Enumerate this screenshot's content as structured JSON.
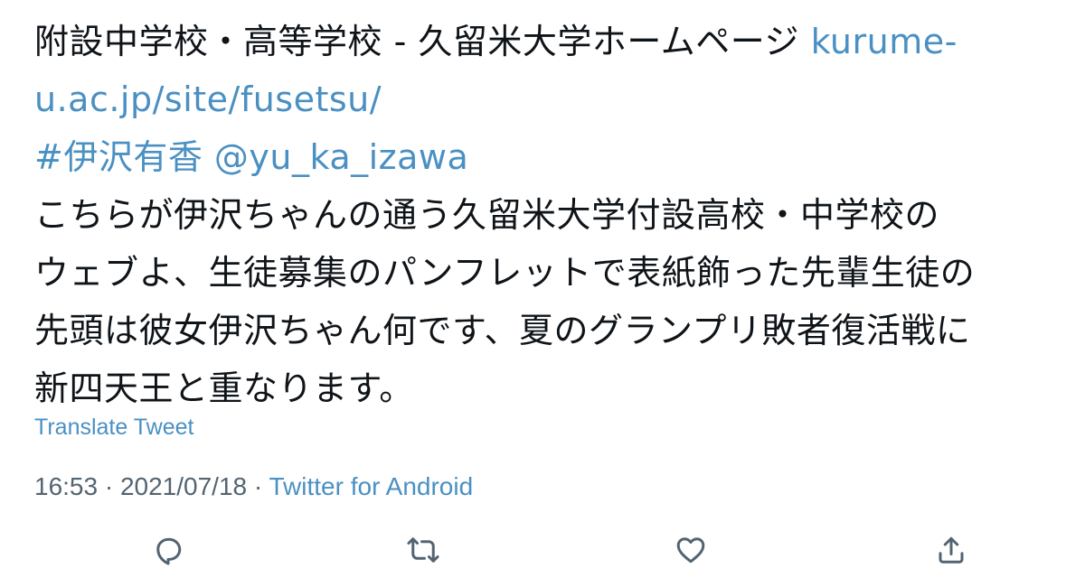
{
  "tweet": {
    "lines": [
      {
        "text": "附設中学校・高等学校 - 久留米大学ホームページ ",
        "link": "kurume-"
      },
      {
        "text": "",
        "link": "u.ac.jp/site/fusetsu/"
      },
      {
        "text": "",
        "link": "#伊沢有香 @yu_ka_izawa"
      },
      {
        "text": "こちらが伊沢ちゃんの通う久留米大学付設高校・中学校の",
        "link": ""
      },
      {
        "text": "ウェブよ、生徒募集のパンフレットで表紙飾った先輩生徒の",
        "link": ""
      },
      {
        "text": "先頭は彼女伊沢ちゃん何です、夏のグランプリ敗者復活戦に",
        "link": ""
      },
      {
        "text": "新四天王と重なります。",
        "link": ""
      }
    ],
    "translate_label": "Translate Tweet",
    "time": "16:53",
    "separator": " · ",
    "date": "2021/07/18",
    "source": "Twitter for Android"
  },
  "actions": {
    "reply_icon": "reply-icon",
    "retweet_icon": "retweet-icon",
    "like_icon": "like-icon",
    "share_icon": "share-icon"
  },
  "colors": {
    "link": "#4a90c2",
    "text": "#0f1419",
    "meta": "#536471"
  }
}
